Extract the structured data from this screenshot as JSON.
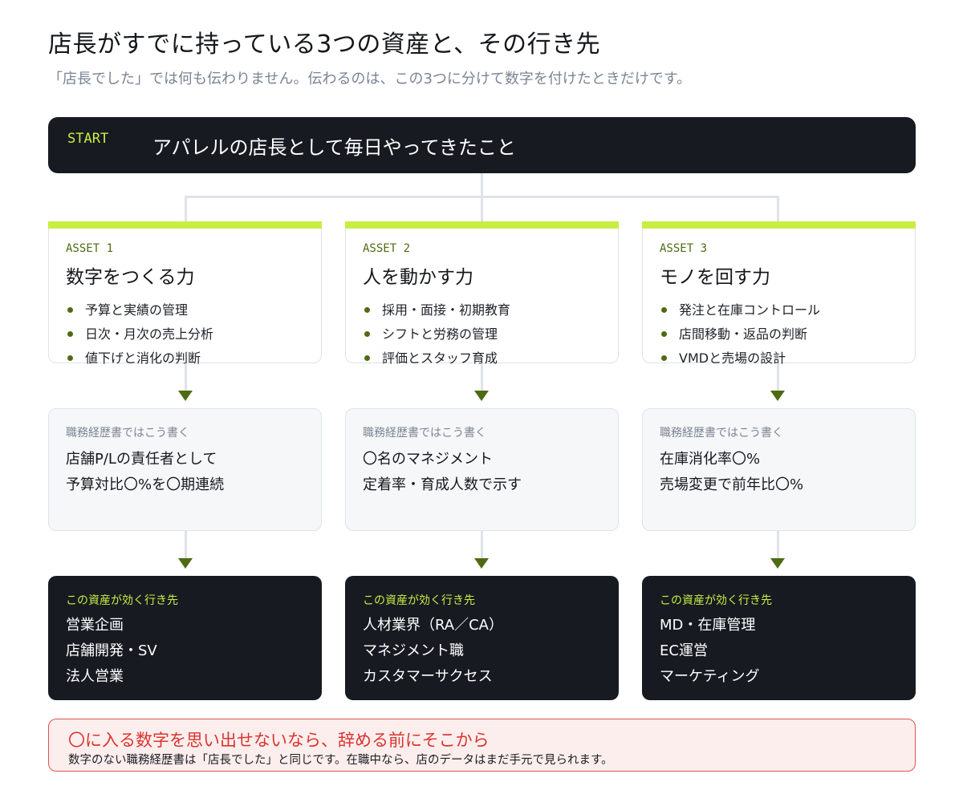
{
  "header": {
    "title": "店長がすでに持っている3つの資産と、その行き先",
    "subtitle": "「店長でした」では何も伝わりません。伝わるのは、この3つに分けて数字を付けたときだけです。"
  },
  "start": {
    "tag": "START",
    "text": "アパレルの店長として毎日やってきたこと"
  },
  "assets": [
    {
      "tag": "ASSET 1",
      "title": "数字をつくる力",
      "items": [
        "予算と実績の管理",
        "日次・月次の売上分析",
        "値下げと消化の判断"
      ],
      "resume_label": "職務経歴書ではこう書く",
      "resume_lines": [
        "店舗P/Lの責任者として",
        "予算対比〇%を〇期連続"
      ],
      "dest_label": "この資産が効く行き先",
      "destinations": [
        "営業企画",
        "店舗開発・SV",
        "法人営業"
      ]
    },
    {
      "tag": "ASSET 2",
      "title": "人を動かす力",
      "items": [
        "採用・面接・初期教育",
        "シフトと労務の管理",
        "評価とスタッフ育成"
      ],
      "resume_label": "職務経歴書ではこう書く",
      "resume_lines": [
        "〇名のマネジメント",
        "定着率・育成人数で示す"
      ],
      "dest_label": "この資産が効く行き先",
      "destinations": [
        "人材業界（RA／CA）",
        "マネジメント職",
        "カスタマーサクセス"
      ]
    },
    {
      "tag": "ASSET 3",
      "title": "モノを回す力",
      "items": [
        "発注と在庫コントロール",
        "店間移動・返品の判断",
        "VMDと売場の設計"
      ],
      "resume_label": "職務経歴書ではこう書く",
      "resume_lines": [
        "在庫消化率〇%",
        "売場変更で前年比〇%"
      ],
      "dest_label": "この資産が効く行き先",
      "destinations": [
        "MD・在庫管理",
        "EC運営",
        "マーケティング"
      ]
    }
  ],
  "warning": {
    "title": "〇に入る数字を思い出せないなら、辞める前にそこから",
    "text": "数字のない職務経歴書は「店長でした」と同じです。在職中なら、店のデータはまだ手元で見られます。"
  },
  "colors": {
    "accent": "#c8ee44",
    "dark": "#171a21",
    "olive": "#4e6b14",
    "warning": "#d9352e"
  }
}
